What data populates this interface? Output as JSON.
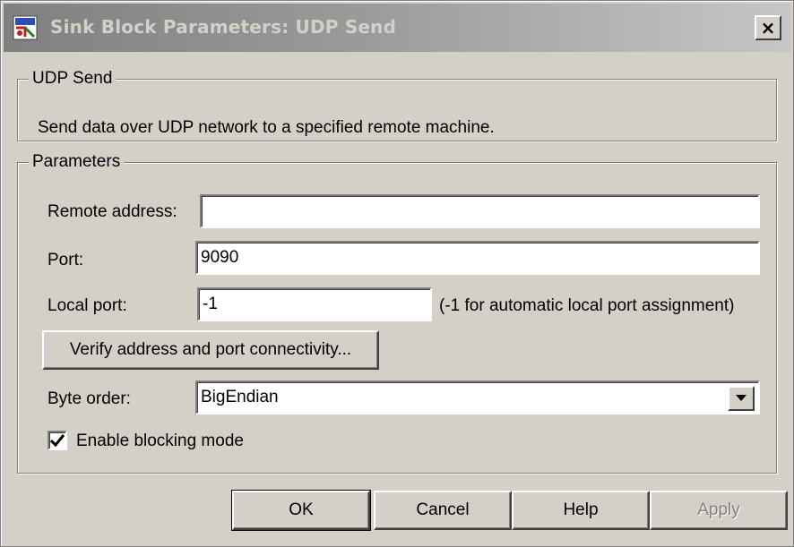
{
  "window": {
    "title": "Sink Block Parameters: UDP Send",
    "close_label": "×"
  },
  "block_group": {
    "legend": "UDP Send",
    "description": "Send data over UDP network to a specified remote machine."
  },
  "params": {
    "legend": "Parameters",
    "remote_address_label": "Remote address:",
    "remote_address_value": "",
    "port_label": "Port:",
    "port_value": "9090",
    "local_port_label": "Local port:",
    "local_port_value": "-1",
    "local_port_hint": "(-1 for automatic local port assignment)",
    "verify_button": "Verify address and port connectivity...",
    "byte_order_label": "Byte order:",
    "byte_order_value": "BigEndian",
    "blocking_label": "Enable blocking mode",
    "blocking_checked": true
  },
  "buttons": {
    "ok": "OK",
    "cancel": "Cancel",
    "help": "Help",
    "apply": "Apply"
  }
}
